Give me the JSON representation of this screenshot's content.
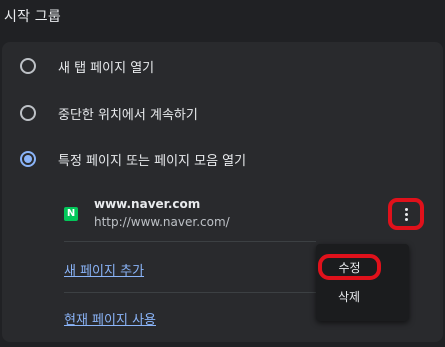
{
  "section": {
    "title": "시작 그룹"
  },
  "startup_options": [
    {
      "label": "새 탭 페이지 열기",
      "selected": false
    },
    {
      "label": "중단한 위치에서 계속하기",
      "selected": false
    },
    {
      "label": "특정 페이지 또는 페이지 모음 열기",
      "selected": true
    }
  ],
  "site": {
    "favicon_letter": "N",
    "favicon_color": "#03c75a",
    "name": "www.naver.com",
    "url": "http://www.naver.com/",
    "more_icon": "more-vert-icon"
  },
  "links": {
    "add_page": "새 페이지 추가",
    "use_current": "현재 페이지 사용"
  },
  "context_menu": {
    "edit": "수정",
    "delete": "삭제"
  },
  "colors": {
    "background": "#202124",
    "card": "#292a2d",
    "accent": "#8ab4f8",
    "highlight": "#e0111b"
  }
}
